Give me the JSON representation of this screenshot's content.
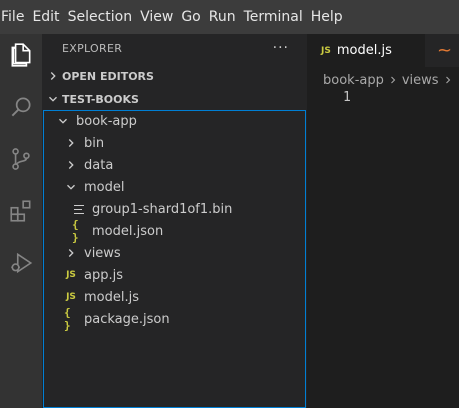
{
  "menubar": {
    "items": [
      "File",
      "Edit",
      "Selection",
      "View",
      "Go",
      "Run",
      "Terminal",
      "Help"
    ]
  },
  "activity_bar": {
    "icons": [
      "files-icon",
      "search-icon",
      "source-control-icon",
      "extensions-icon",
      "run-debug-icon"
    ],
    "active": "files-icon"
  },
  "sidebar": {
    "title": "EXPLORER",
    "more_label": "···",
    "open_editors_label": "OPEN EDITORS",
    "workspace_label": "TEST-BOOKS",
    "tree": [
      {
        "label": "book-app",
        "kind": "folder-open",
        "depth": 1
      },
      {
        "label": "bin",
        "kind": "folder-closed",
        "depth": 2
      },
      {
        "label": "data",
        "kind": "folder-closed",
        "depth": 2
      },
      {
        "label": "model",
        "kind": "folder-open",
        "depth": 2
      },
      {
        "label": "group1-shard1of1.bin",
        "kind": "file",
        "depth": 3
      },
      {
        "label": "model.json",
        "kind": "json",
        "depth": 3
      },
      {
        "label": "views",
        "kind": "folder-closed",
        "depth": 2
      },
      {
        "label": "app.js",
        "kind": "js",
        "depth": 2
      },
      {
        "label": "model.js",
        "kind": "js",
        "depth": 2
      },
      {
        "label": "package.json",
        "kind": "json",
        "depth": 2
      }
    ]
  },
  "editor": {
    "tab_label": "model.js",
    "tab_icon_text": "JS",
    "second_tab_icon": "~",
    "breadcrumb": [
      "book-app",
      "views"
    ],
    "line_number": "1"
  },
  "icons": {
    "js_text": "JS",
    "json_text": "{ }"
  },
  "colors": {
    "accent": "#007fd4",
    "js_icon": "#cbcb41",
    "menubar_bg": "#3c3c3c",
    "sidebar_bg": "#252526",
    "editor_bg": "#1e1e1e",
    "activity_bg": "#333333"
  }
}
